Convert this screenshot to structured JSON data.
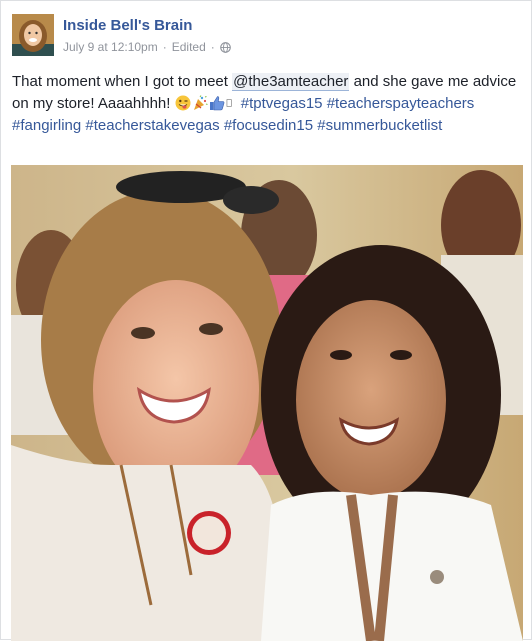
{
  "post": {
    "author": "Inside Bell's Brain",
    "timestamp": "July 9 at 12:10pm",
    "separator": "·",
    "edited": "Edited",
    "privacy_icon": "globe-icon",
    "text": {
      "line1_before": "That moment when I got to meet ",
      "mention": "@the3amteacher",
      "line1_after": " and she gave me advice on my store! Aaaahhhh! ",
      "emojis": [
        "tongue-wink-emoji",
        "party-popper-emoji",
        "thumbs-up-emoji",
        "unsupported-glyph"
      ],
      "hashtags": [
        "#tptvegas15",
        "#teacherspayteachers",
        "#fangirling",
        "#teacherstakevegas",
        "#focusedin15",
        "#summerbucketlist"
      ]
    },
    "photo_icon": "selfie-photo"
  },
  "colors": {
    "link": "#365899",
    "text": "#1d2129",
    "meta": "#90949c",
    "border": "#dddfe2"
  }
}
